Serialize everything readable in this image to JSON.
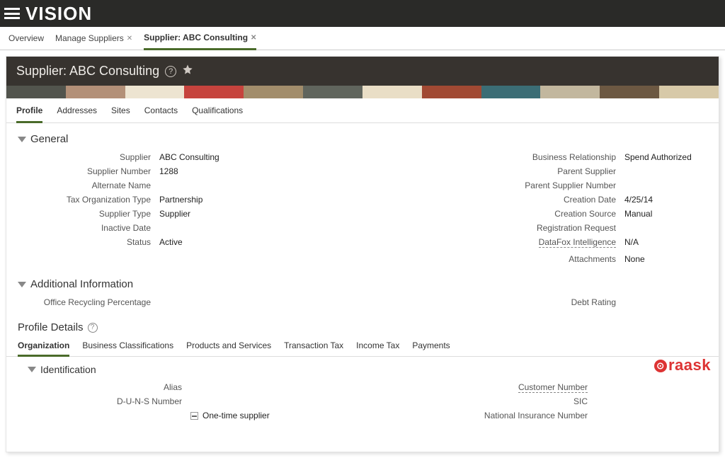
{
  "brand": "VISION",
  "nav_tabs": [
    {
      "label": "Overview",
      "closable": false,
      "active": false
    },
    {
      "label": "Manage Suppliers",
      "closable": true,
      "active": false
    },
    {
      "label": "Supplier: ABC Consulting",
      "closable": true,
      "active": true
    }
  ],
  "page_title": "Supplier: ABC Consulting",
  "subtabs": [
    "Profile",
    "Addresses",
    "Sites",
    "Contacts",
    "Qualifications"
  ],
  "active_subtab": "Profile",
  "sections": {
    "general_header": "General",
    "additional_header": "Additional Information",
    "profile_details_header": "Profile Details",
    "identification_header": "Identification"
  },
  "general_left": {
    "supplier_label": "Supplier",
    "supplier_value": "ABC Consulting",
    "supplier_number_label": "Supplier Number",
    "supplier_number_value": "1288",
    "alternate_name_label": "Alternate Name",
    "alternate_name_value": "",
    "tax_org_type_label": "Tax Organization Type",
    "tax_org_type_value": "Partnership",
    "supplier_type_label": "Supplier Type",
    "supplier_type_value": "Supplier",
    "inactive_date_label": "Inactive Date",
    "inactive_date_value": "",
    "status_label": "Status",
    "status_value": "Active"
  },
  "general_right": {
    "biz_rel_label": "Business Relationship",
    "biz_rel_value": "Spend Authorized",
    "parent_supplier_label": "Parent Supplier",
    "parent_supplier_value": "",
    "parent_supplier_num_label": "Parent Supplier Number",
    "parent_supplier_num_value": "",
    "creation_date_label": "Creation Date",
    "creation_date_value": "4/25/14",
    "creation_source_label": "Creation Source",
    "creation_source_value": "Manual",
    "registration_request_label": "Registration Request",
    "registration_request_value": "",
    "datafox_label": "DataFox Intelligence",
    "datafox_value": "N/A",
    "attachments_label": "Attachments",
    "attachments_value": "None"
  },
  "additional": {
    "recycle_label": "Office Recycling Percentage",
    "recycle_value": "",
    "debt_label": "Debt Rating",
    "debt_value": ""
  },
  "detail_tabs": [
    "Organization",
    "Business Classifications",
    "Products and Services",
    "Transaction Tax",
    "Income Tax",
    "Payments"
  ],
  "active_detail_tab": "Organization",
  "identification_left": {
    "alias_label": "Alias",
    "alias_value": "",
    "duns_label": "D-U-N-S Number",
    "duns_value": "",
    "onetime_supplier_label": "One-time supplier"
  },
  "identification_right": {
    "customer_number_label": "Customer Number",
    "customer_number_value": "",
    "sic_label": "SIC",
    "sic_value": "",
    "nin_label": "National Insurance Number",
    "nin_value": ""
  },
  "watermark_text": "raask",
  "colorstrip_colors": [
    "#52544d",
    "#b39078",
    "#ede4d1",
    "#c6433d",
    "#a28d6b",
    "#60655d",
    "#e9dec6",
    "#a14933",
    "#3b6d75",
    "#c2b79e",
    "#6c5842",
    "#d7c9a8"
  ]
}
